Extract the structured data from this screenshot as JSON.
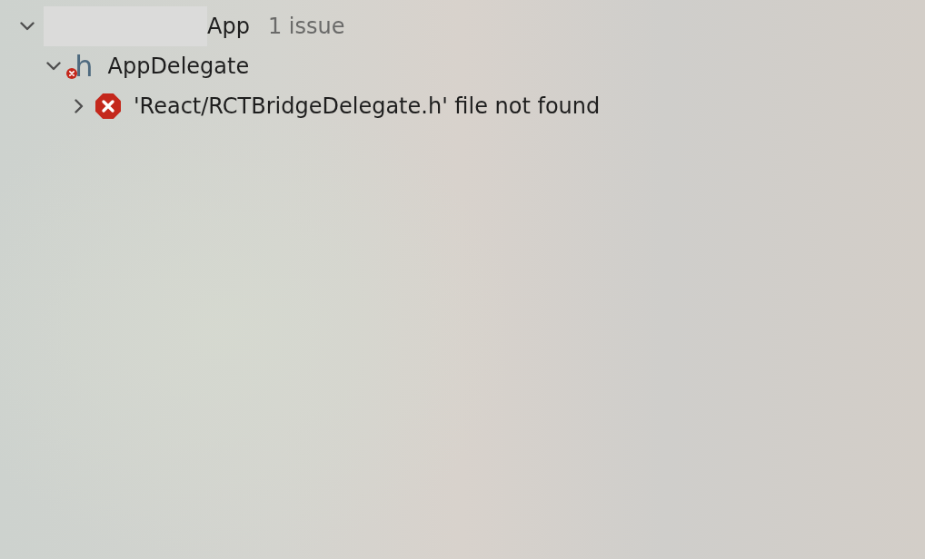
{
  "navigator": {
    "nodes": [
      {
        "kind": "project",
        "name_redacted": true,
        "name": "App",
        "issue_count": "1 issue",
        "expanded": true,
        "children": [
          {
            "kind": "file",
            "file_type": "h",
            "name": "AppDelegate",
            "has_error": true,
            "expanded": true,
            "children": [
              {
                "kind": "error",
                "message": "'React/RCTBridgeDelegate.h' file not found",
                "expanded": false
              }
            ]
          }
        ]
      }
    ]
  }
}
